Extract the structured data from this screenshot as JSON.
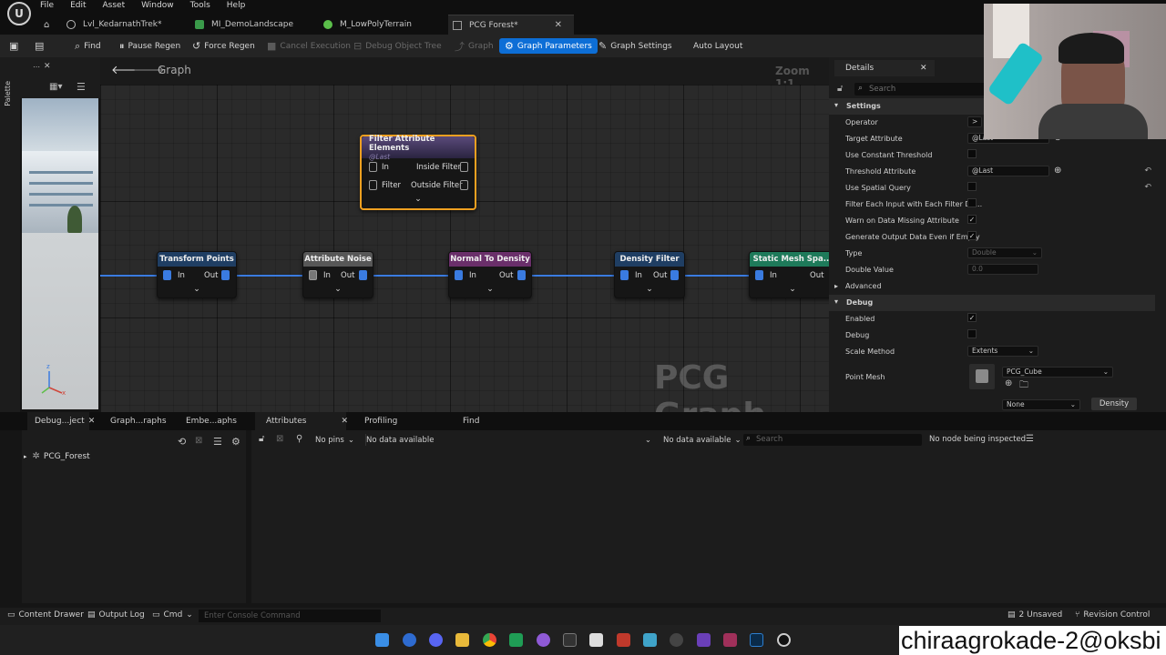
{
  "menubar": {
    "items": [
      "File",
      "Edit",
      "Asset",
      "Window",
      "Tools",
      "Help"
    ]
  },
  "tabs": [
    {
      "label": "Lvl_KedarnathTrek*"
    },
    {
      "label": "MI_DemoLandscape"
    },
    {
      "label": "M_LowPolyTerrain"
    },
    {
      "label": "PCG Forest*"
    }
  ],
  "toolbar": {
    "find": "Find",
    "pause_regen": "Pause Regen",
    "force_regen": "Force Regen",
    "cancel_execution": "Cancel Execution",
    "debug_object_tree": "Debug Object Tree",
    "graph": "Graph",
    "graph_parameters": "Graph Parameters",
    "graph_settings": "Graph Settings",
    "auto_layout": "Auto Layout"
  },
  "palette": {
    "label": "Palette"
  },
  "graph": {
    "title": "Graph",
    "zoom": "Zoom 1:1",
    "watermark": "PCG Graph",
    "filter_node": {
      "title": "Filter Attribute Elements",
      "subtitle": "@Last",
      "pin_in": "In",
      "pin_filter": "Filter",
      "pin_inside": "Inside Filter",
      "pin_outside": "Outside Filter"
    },
    "chain": [
      {
        "title": "Transform Points",
        "in": "In",
        "out": "Out",
        "color": "#1f3e63"
      },
      {
        "title": "Attribute Noise",
        "in": "In",
        "out": "Out",
        "color": "#575757"
      },
      {
        "title": "Normal To Density",
        "in": "In",
        "out": "Out",
        "color": "#6a2f6a"
      },
      {
        "title": "Density Filter",
        "in": "In",
        "out": "Out",
        "color": "#1f3e63"
      },
      {
        "title": "Static Mesh Spa...",
        "in": "In",
        "out": "Out",
        "color": "#1e7a5a"
      }
    ]
  },
  "details": {
    "title": "Details",
    "search_placeholder": "Search",
    "settings_section": "Settings",
    "operator": "Operator",
    "operator_value": ">",
    "target_attribute": "Target Attribute",
    "target_attribute_value": "@Last",
    "use_constant_threshold": "Use Constant Threshold",
    "threshold_attribute": "Threshold Attribute",
    "threshold_attribute_value": "@Last",
    "use_spatial_query": "Use Spatial Query",
    "filter_each_input": "Filter Each Input with Each Filter Da...",
    "warn_missing": "Warn on Data Missing Attribute",
    "generate_output": "Generate Output Data Even if Empty",
    "type": "Type",
    "type_value": "Double",
    "double_value": "Double Value",
    "double_value_value": "0.0",
    "advanced_section": "Advanced",
    "debug_section": "Debug",
    "enabled": "Enabled",
    "debug": "Debug",
    "scale_method": "Scale Method",
    "scale_method_value": "Extents",
    "point_mesh": "Point Mesh",
    "point_mesh_value": "PCG_Cube",
    "none_value": "None",
    "density_button": "Density"
  },
  "bottom_tabs": {
    "debug_object": "Debug...ject",
    "graphs": "Graph...raphs",
    "embedded": "Embe...aphs",
    "attributes": "Attributes",
    "profiling": "Profiling",
    "find": "Find"
  },
  "outliner": {
    "item": "PCG_Forest"
  },
  "attributes_panel": {
    "pins": "No pins",
    "data1": "No data available",
    "data2": "No data available",
    "search_placeholder": "Search",
    "status": "No node being inspected"
  },
  "statusbar": {
    "content_drawer": "Content Drawer",
    "output_log": "Output Log",
    "cmd": "Cmd",
    "console_placeholder": "Enter Console Command",
    "unsaved": "2 Unsaved",
    "revision_control": "Revision Control"
  },
  "overlay": {
    "watermark": "chiraagrokade-2@oksbi"
  }
}
